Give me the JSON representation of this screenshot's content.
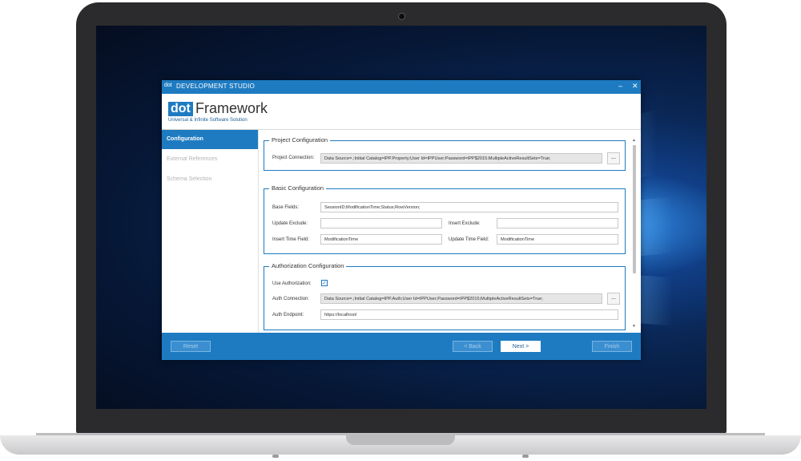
{
  "window": {
    "app_logo": "dot",
    "title": "DEVELOPMENT STUDIO",
    "minimize": "–",
    "close": "✕"
  },
  "header": {
    "logo_dot": "dot",
    "logo_framework": "Framework",
    "subtitle": "Universal & Infinite Software Solution"
  },
  "sidebar": {
    "items": [
      {
        "label": "Configuration"
      },
      {
        "label": "External References"
      },
      {
        "label": "Schema Selection"
      }
    ]
  },
  "project": {
    "title": "Project Configuration",
    "connection_label": "Project Connection:",
    "connection_value": "Data Source=.;Initial Catalog=IPP.Property;User Id=IPPUser;Password=IPP$2015;MultipleActiveResultSets=True;",
    "browse": "..."
  },
  "basic": {
    "title": "Basic Configuration",
    "base_fields_label": "Base Fields:",
    "base_fields_value": "SessionID;ModificationTime;Status;RowVersion;",
    "update_exclude_label": "Update Exclude:",
    "update_exclude_value": "",
    "insert_exclude_label": "Insert Exclude:",
    "insert_exclude_value": "",
    "insert_time_label": "Insert Time Field:",
    "insert_time_value": "ModificationTime",
    "update_time_label": "Update Time Field:",
    "update_time_value": "ModificationTime"
  },
  "auth": {
    "title": "Authorization Configuration",
    "use_auth_label": "Use Authorization:",
    "use_auth_checked": true,
    "check_mark": "✓",
    "connection_label": "Auth Connection:",
    "connection_value": "Data Source=.;Initial Catalog=IPP.Auth;User Id=IPPUser;Password=IPP$2015;MultipleActiveResultSets=True;",
    "browse": "...",
    "endpoint_label": "Auth Endpoint:",
    "endpoint_value": "https://localhost/"
  },
  "scroll": {
    "up": "▲",
    "down": "▼"
  },
  "footer": {
    "reset": "Reset",
    "back": "< Back",
    "next": "Next >",
    "finish": "Finish"
  },
  "colors": {
    "accent": "#1e7bc1",
    "desktop_dark": "#0a2756",
    "desktop_glow": "#6fc3ff"
  }
}
